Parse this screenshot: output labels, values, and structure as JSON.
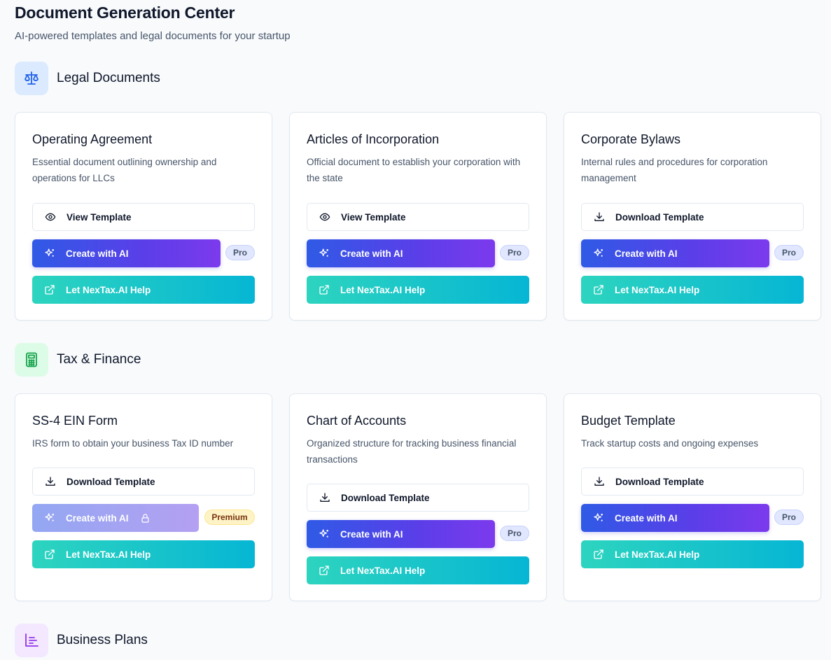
{
  "header": {
    "title": "Document Generation Center",
    "subtitle": "AI-powered templates and legal documents for your startup"
  },
  "sections": [
    {
      "title": "Legal Documents",
      "icon": "scale-icon",
      "icon_color": "#2563eb",
      "icon_bg": "#dbeafe",
      "cards": [
        {
          "title": "Operating Agreement",
          "description": "Essential document outlining ownership and operations for LLCs",
          "template_button": "View Template",
          "template_icon": "eye-icon",
          "ai_button": "Create with AI",
          "badge": "Pro",
          "help_button": "Let NexTax.AI Help"
        },
        {
          "title": "Articles of Incorporation",
          "description": "Official document to establish your corporation with the state",
          "template_button": "View Template",
          "template_icon": "eye-icon",
          "ai_button": "Create with AI",
          "badge": "Pro",
          "help_button": "Let NexTax.AI Help"
        },
        {
          "title": "Corporate Bylaws",
          "description": "Internal rules and procedures for corporation management",
          "template_button": "Download Template",
          "template_icon": "download-icon",
          "ai_button": "Create with AI",
          "badge": "Pro",
          "help_button": "Let NexTax.AI Help"
        }
      ]
    },
    {
      "title": "Tax & Finance",
      "icon": "calculator-icon",
      "icon_color": "#16a34a",
      "icon_bg": "#dcfce7",
      "cards": [
        {
          "title": "SS-4 EIN Form",
          "description": "IRS form to obtain your business Tax ID number",
          "template_button": "Download Template",
          "template_icon": "download-icon",
          "ai_button": "Create with AI",
          "ai_locked": true,
          "badge": "Premium",
          "help_button": "Let NexTax.AI Help"
        },
        {
          "title": "Chart of Accounts",
          "description": "Organized structure for tracking business financial transactions",
          "template_button": "Download Template",
          "template_icon": "download-icon",
          "ai_button": "Create with AI",
          "badge": "Pro",
          "help_button": "Let NexTax.AI Help"
        },
        {
          "title": "Budget Template",
          "description": "Track startup costs and ongoing expenses",
          "template_button": "Download Template",
          "template_icon": "download-icon",
          "ai_button": "Create with AI",
          "badge": "Pro",
          "help_button": "Let NexTax.AI Help"
        }
      ]
    },
    {
      "title": "Business Plans",
      "icon": "chart-icon",
      "icon_color": "#9333ea",
      "icon_bg": "#f3e8ff",
      "cards": []
    }
  ]
}
